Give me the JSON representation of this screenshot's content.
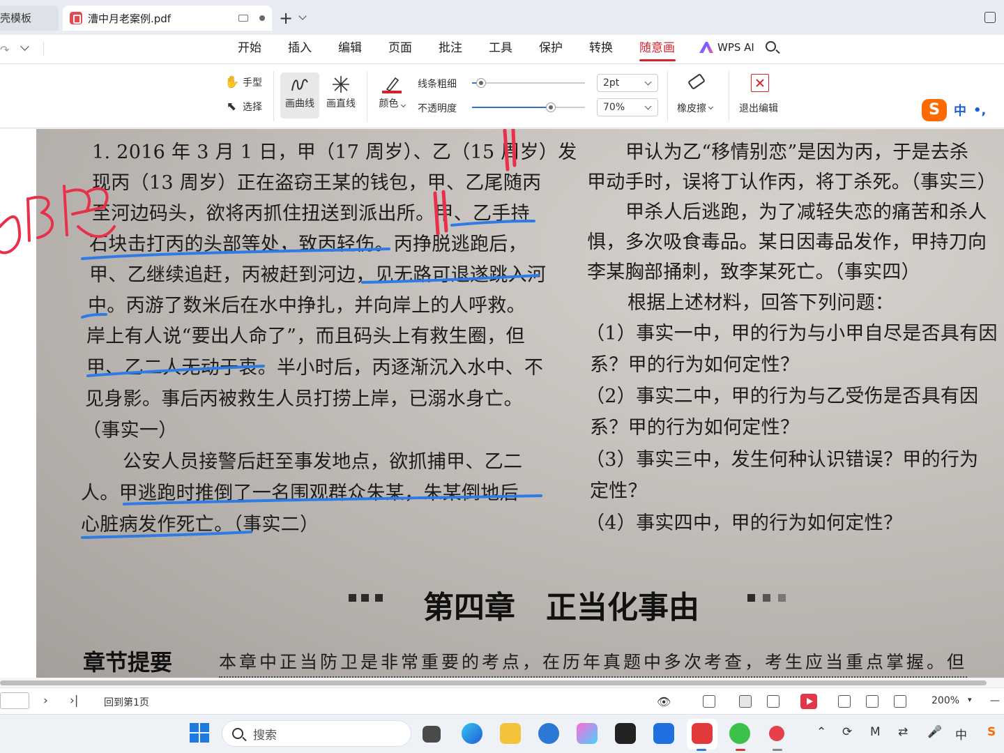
{
  "tabs": {
    "prev": "壳模板",
    "active": "漕中月老案例.pdf"
  },
  "menu": {
    "items": [
      "开始",
      "插入",
      "编辑",
      "页面",
      "批注",
      "工具",
      "保护",
      "转换",
      "随意画"
    ],
    "active": "随意画",
    "ai_label": "WPS AI"
  },
  "ribbon": {
    "hand": "手型",
    "select": "选择",
    "curve": "画曲线",
    "straight": "画直线",
    "color": "颜色",
    "thickness_label": "线条粗细",
    "thickness_value": "2pt",
    "thickness_fraction": 0.08,
    "opacity_label": "不透明度",
    "opacity_value": "70%",
    "opacity_fraction": 0.7,
    "eraser": "橡皮擦",
    "exit": "退出编辑",
    "pen_color": "#d4232c"
  },
  "ime": {
    "lang": "中",
    "punct": "•,"
  },
  "document": {
    "left_lines": [
      "1. 2016 年 3 月 1 日，甲（17 周岁）、乙（15 周岁）发",
      "现丙（13 周岁）正在盗窃王某的钱包，甲、乙尾随丙",
      "至河边码头，欲将丙抓住扭送到派出所。甲、乙手持",
      "石块击打丙的头部等处，致丙轻伤。丙挣脱逃跑后，",
      "甲、乙继续追赶，丙被赶到河边，见无路可退遂跳入河",
      "中。丙游了数米后在水中挣扎，并向岸上的人呼救。",
      "岸上有人说“要出人命了”，而且码头上有救生圈，但",
      "甲、乙二人无动于衷。半小时后，丙逐渐沉入水中、不",
      "见身影。事后丙被救生人员打捞上岸，已溺水身亡。",
      "（事实一）",
      "公安人员接警后赶至事发地点，欲抓捕甲、乙二",
      "人。甲逃跑时推倒了一名围观群众朱某，朱某倒地后",
      "心脏病发作死亡。（事实二）"
    ],
    "right_lines": [
      "甲认为乙“移情别恋”是因为丙，于是去杀",
      "甲动手时，误将丁认作丙，将丁杀死。（事实三）",
      "甲杀人后逃跑，为了减轻失恋的痛苦和杀人",
      "惧，多次吸食毒品。某日因毒品发作，甲持刀向",
      "李某胸部捅刺，致李某死亡。（事实四）",
      "根据上述材料，回答下列问题：",
      "（1）事实一中，甲的行为与小甲自尽是否具有因",
      "系？甲的行为如何定性？",
      "（2）事实二中，甲的行为与乙受伤是否具有因",
      "系？甲的行为如何定性？",
      "（3）事实三中，发生何种认识错误？甲的行为",
      "定性？",
      "（4）事实四中，甲的行为如何定性？"
    ],
    "chapter_title": "第四章　正当化事由",
    "summary_heading": "章节提要",
    "summary_text": "本章中正当防卫是非常重要的考点，在历年真题中多次考查，考生应当重点掌握。但",
    "ink_note": "防卫",
    "ink_colors": {
      "red": "#e8304a",
      "blue": "#2f7be6"
    }
  },
  "status": {
    "back_to_first": "回到第1页",
    "zoom": "200%"
  },
  "taskbar": {
    "search_placeholder": "搜索",
    "ime": "中"
  }
}
